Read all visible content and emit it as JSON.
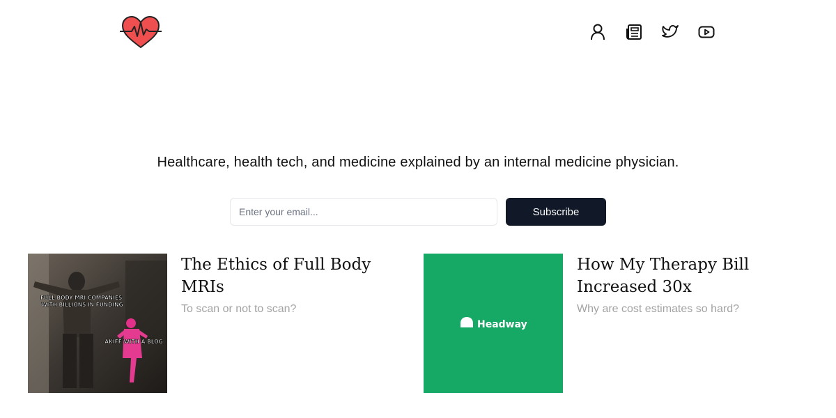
{
  "header": {
    "logo_icon": "heart-pulse-icon",
    "accent_color": "#ef4444",
    "nav": [
      {
        "icon": "user-icon",
        "label": "Account"
      },
      {
        "icon": "newspaper-icon",
        "label": "Archive"
      },
      {
        "icon": "twitter-icon",
        "label": "Twitter"
      },
      {
        "icon": "youtube-icon",
        "label": "YouTube"
      }
    ]
  },
  "hero": {
    "tagline": "Healthcare, health tech, and medicine explained by an internal medicine physician."
  },
  "subscribe": {
    "email_placeholder": "Enter your email...",
    "email_value": "",
    "button_label": "Subscribe",
    "button_color": "#111827"
  },
  "posts": [
    {
      "title": "The Ethics of Full Body MRIs",
      "subtitle": "To scan or not to scan?",
      "image": {
        "caption_top": "FULL BODY MRI COMPANIES WITH BILLIONS IN FUNDING",
        "caption_bottom": "AKIFF WITH A BLOG"
      }
    },
    {
      "title": "How My Therapy Bill Increased 30x",
      "subtitle": "Why are cost estimates so hard?",
      "image": {
        "brand": "Headway",
        "background": "#16a865"
      }
    }
  ]
}
